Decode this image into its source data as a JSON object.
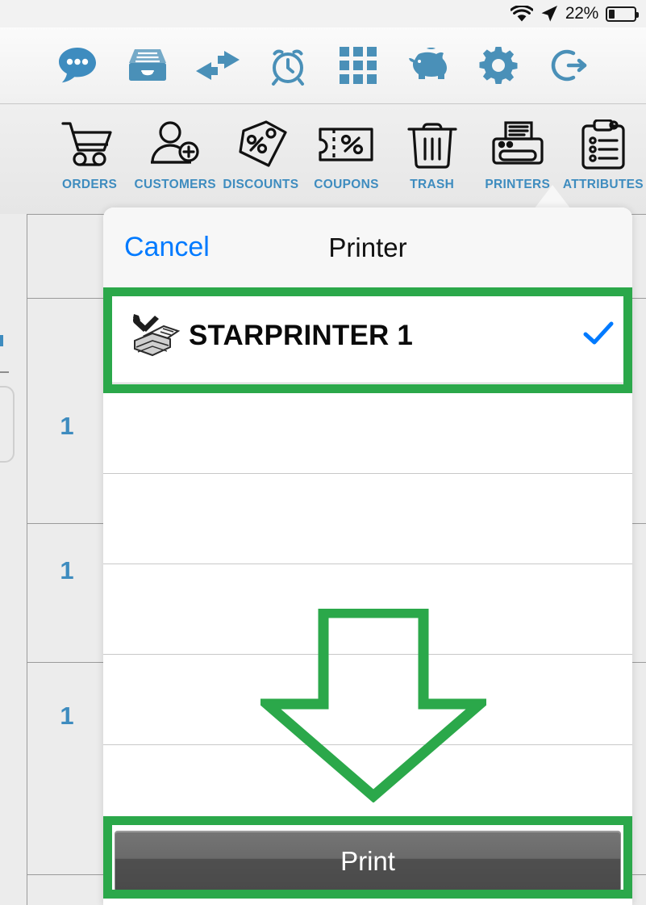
{
  "status_bar": {
    "wifi_icon": "wifi-icon",
    "location_icon": "location-arrow-icon",
    "battery_percent": "22%",
    "battery_level": 22
  },
  "top_toolbar": {
    "accent_color": "#3e8cbf",
    "items": [
      {
        "icon": "chat-bubble-icon",
        "name": "messages"
      },
      {
        "icon": "file-drawer-icon",
        "name": "archive"
      },
      {
        "icon": "exchange-arrows-icon",
        "name": "transfer"
      },
      {
        "icon": "alarm-clock-icon",
        "name": "alarm"
      },
      {
        "icon": "grid-icon",
        "name": "grid"
      },
      {
        "icon": "piggy-bank-icon",
        "name": "cash"
      },
      {
        "icon": "gear-icon",
        "name": "settings"
      },
      {
        "icon": "logout-icon",
        "name": "logout"
      }
    ]
  },
  "tool_toolbar": {
    "label_color": "#3e8cbf",
    "items": [
      {
        "label": "ORDERS",
        "icon": "shopping-cart-icon"
      },
      {
        "label": "CUSTOMERS",
        "icon": "add-user-icon"
      },
      {
        "label": "DISCOUNTS",
        "icon": "price-tag-percent-icon"
      },
      {
        "label": "COUPONS",
        "icon": "coupon-ticket-icon"
      },
      {
        "label": "TRASH",
        "icon": "trash-can-icon"
      },
      {
        "label": "PRINTERS",
        "icon": "printer-icon"
      },
      {
        "label": "ATTRIBUTES",
        "icon": "clipboard-list-icon"
      }
    ]
  },
  "background_table": {
    "quantity_color": "#3e8cbf",
    "quantities": [
      "1",
      "1",
      "1"
    ]
  },
  "popover": {
    "cancel_label": "Cancel",
    "cancel_color": "#007aff",
    "title": "Printer",
    "printers": [
      {
        "name": "STARPRINTER 1",
        "icon": "printer-setup-icon",
        "selected": true,
        "check_icon": "checkmark-icon"
      }
    ],
    "empty_row_count": 5,
    "print_button_label": "Print"
  },
  "annotations": {
    "highlight_color": "#2ba84a",
    "boxes": [
      "printer-row-highlight",
      "print-button-highlight"
    ],
    "arrow": "down-arrow-annotation"
  }
}
